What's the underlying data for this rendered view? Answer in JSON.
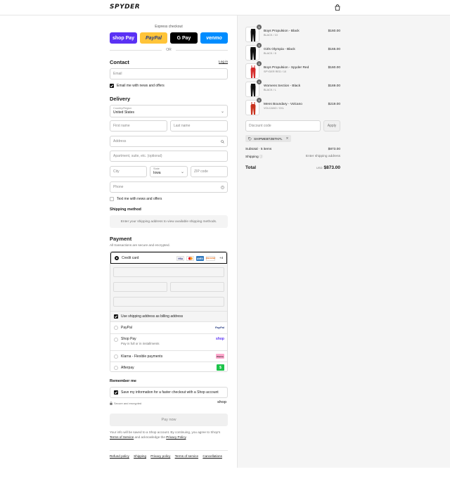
{
  "brand": {
    "logo_text": "SPYDER"
  },
  "express": {
    "title": "Express checkout",
    "buttons": [
      {
        "label": "shop Pay",
        "color": "#5a31f4"
      },
      {
        "label": "PayPal",
        "color": "#ffc439"
      },
      {
        "label": "G Pay",
        "color": "#000000"
      },
      {
        "label": "venmo",
        "color": "#008cff"
      }
    ],
    "or": "OR"
  },
  "contact": {
    "title": "Contact",
    "login": "Log in",
    "email_placeholder": "Email",
    "newsletter_label": "Email me with news and offers",
    "newsletter_checked": true
  },
  "delivery": {
    "title": "Delivery",
    "country_label": "Country/Region",
    "country_value": "United States",
    "first_name": "First name",
    "last_name": "Last name",
    "address": "Address",
    "apartment": "Apartment, suite, etc. (optional)",
    "city": "City",
    "state_label": "State",
    "state_value": "Iowa",
    "zip": "ZIP code",
    "phone": "Phone",
    "text_label": "Text me with news and offers"
  },
  "shipping": {
    "title": "Shipping method",
    "message": "Enter your shipping address to view available shipping methods."
  },
  "payment": {
    "title": "Payment",
    "subtitle": "All transactions are secure and encrypted.",
    "credit_card": "Credit card",
    "card_icons": [
      "VISA",
      "MC",
      "AMEX",
      "DISCOVER"
    ],
    "more_cards": "+4",
    "billing_label": "Use shipping address as billing address",
    "methods": [
      {
        "label": "PayPal",
        "badge": "PayPal"
      },
      {
        "label": "Shop Pay",
        "sub": "Pay in full or in installments",
        "badge": "shop"
      },
      {
        "label": "Klarna - Flexible payments",
        "badge": "Klarna"
      },
      {
        "label": "Afterpay",
        "badge": "$"
      }
    ]
  },
  "remember": {
    "title": "Remember me",
    "label": "Save my information for a faster checkout with a Shop account",
    "secure": "Secure and encrypted",
    "shop": "shop"
  },
  "pay_now": "Pay now",
  "legal": {
    "text_before": "Your info will be saved to a Shop account. By continuing, you agree to Shop's",
    "terms": "Terms of Service",
    "text_mid": "and acknowledge the",
    "privacy": "Privacy Policy",
    "text_end": "."
  },
  "footer_links": [
    "Refund policy",
    "Shipping",
    "Privacy policy",
    "Terms of service",
    "Cancellations"
  ],
  "order": {
    "items": [
      {
        "name": "Boys Propulsion - Black",
        "variant": "BLACK / 10",
        "price": "$160.00",
        "qty": "1",
        "color": "#111111"
      },
      {
        "name": "Girls Olympia - Black",
        "variant": "BLACK / 8",
        "price": "$165.00",
        "qty": "1",
        "color": "#111111"
      },
      {
        "name": "Boys Propulsion - Spyder Red",
        "variant": "SPYDER RED / 10",
        "price": "$160.00",
        "qty": "1",
        "color": "#d42a2a"
      },
      {
        "name": "Womens Section - Black",
        "variant": "BLACK / L",
        "price": "$169.00",
        "qty": "1",
        "color": "#111111"
      },
      {
        "name": "Mens Boundary - Volcano",
        "variant": "VOLCANO / XXL",
        "price": "$219.00",
        "qty": "1",
        "color": "#c8321e"
      }
    ],
    "discount_placeholder": "Discount code",
    "apply": "Apply",
    "code": "SHIPMEBTZBTKFL",
    "subtotal_label": "Subtotal · 5 items",
    "subtotal_value": "$873.00",
    "shipping_label": "Shipping",
    "shipping_value": "Enter shipping address",
    "total_label": "Total",
    "currency": "USD",
    "total_value": "$873.00"
  }
}
